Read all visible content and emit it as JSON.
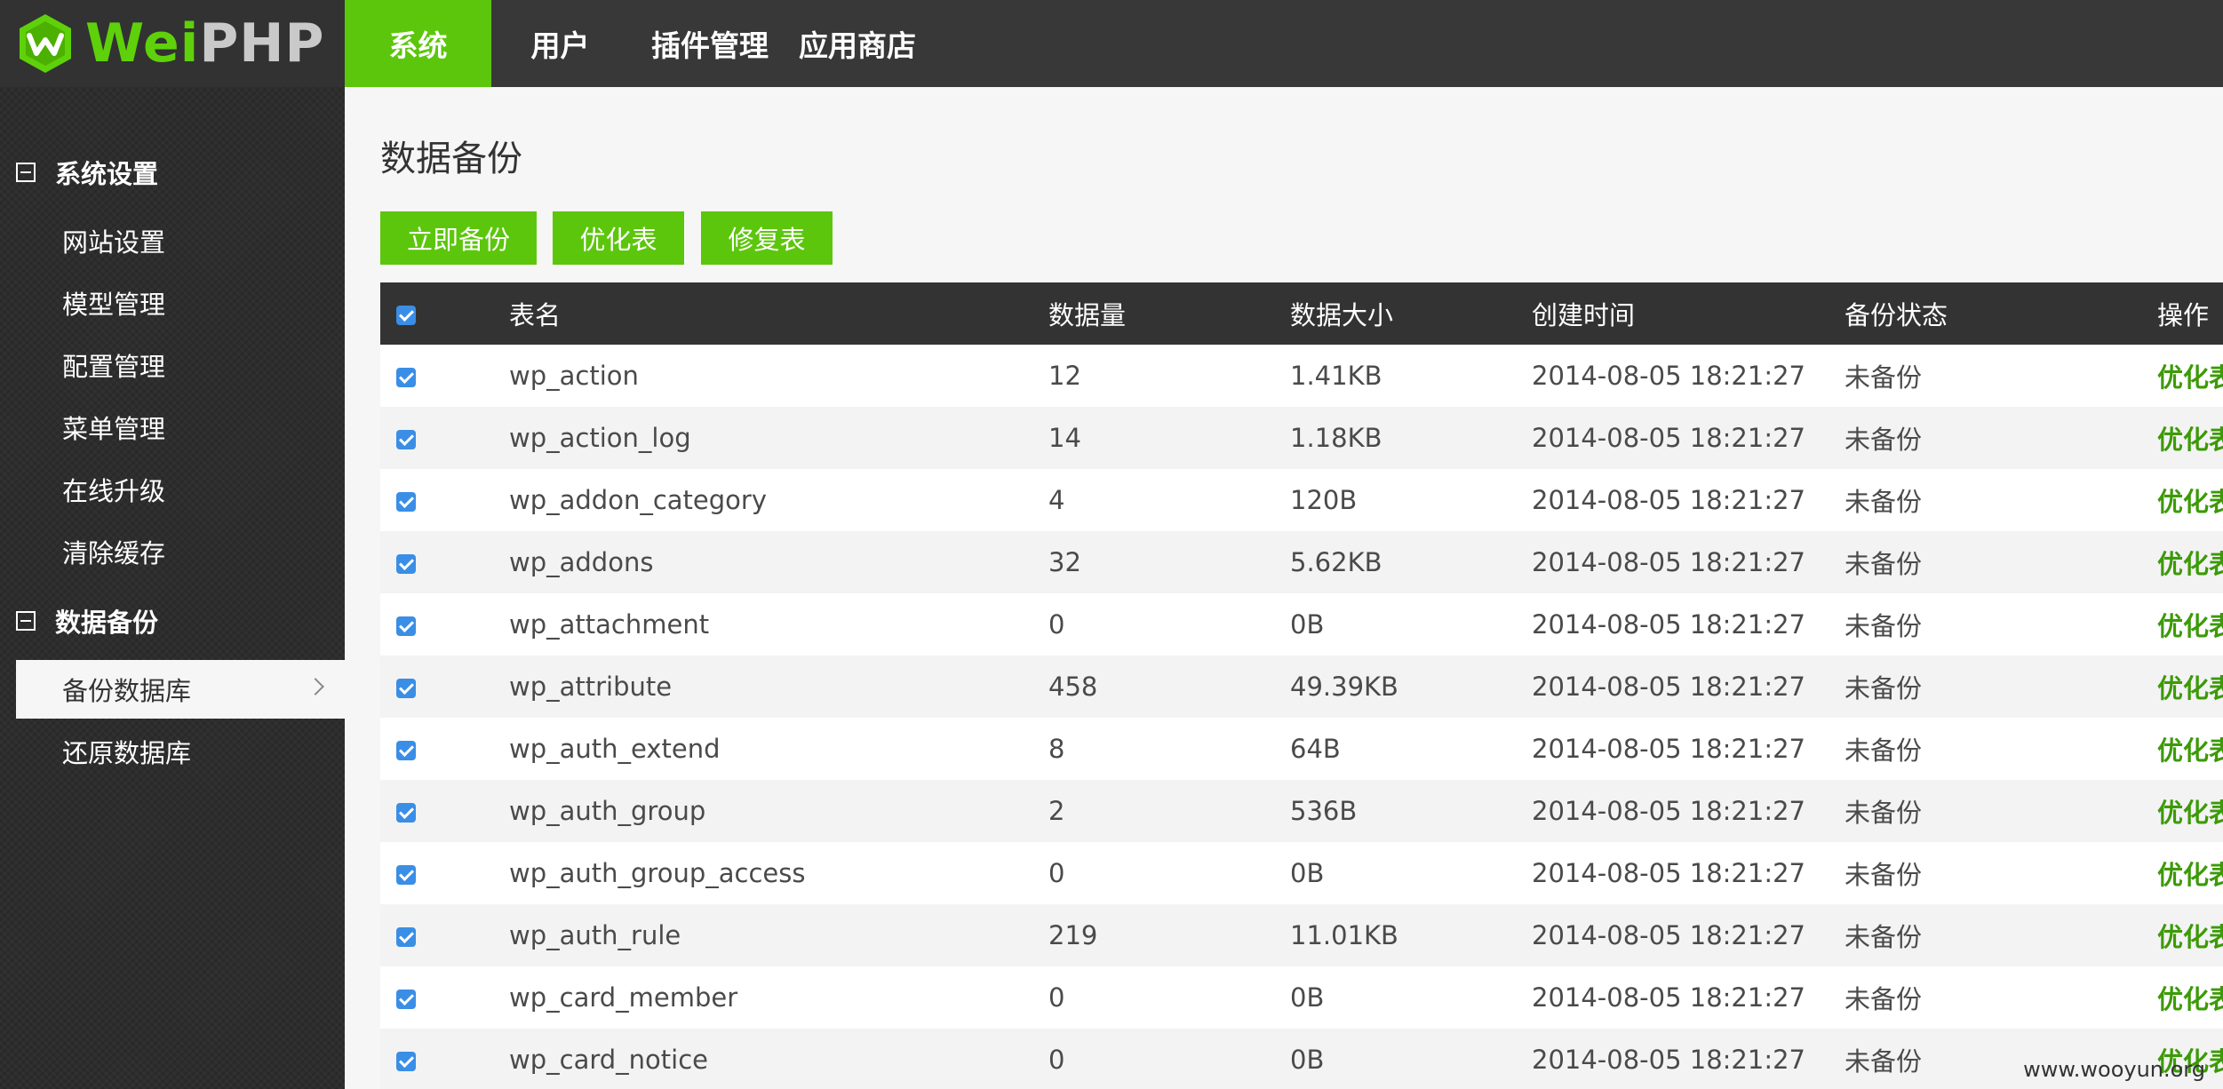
{
  "brand": {
    "wei": "Wei",
    "php": "PHP"
  },
  "topnav": [
    {
      "label": "系统",
      "active": true
    },
    {
      "label": "用户"
    },
    {
      "label": "插件管理"
    },
    {
      "label": "应用商店"
    }
  ],
  "sidebar": {
    "groups": [
      {
        "label": "系统设置",
        "items": [
          "网站设置",
          "模型管理",
          "配置管理",
          "菜单管理",
          "在线升级",
          "清除缓存"
        ]
      },
      {
        "label": "数据备份",
        "items": [
          "备份数据库",
          "还原数据库"
        ]
      }
    ],
    "active_item": "备份数据库"
  },
  "page": {
    "title": "数据备份",
    "buttons": {
      "backup": "立即备份",
      "optimize": "优化表",
      "repair": "修复表"
    }
  },
  "table": {
    "headers": [
      "表名",
      "数据量",
      "数据大小",
      "创建时间",
      "备份状态",
      "操作"
    ],
    "rows": [
      {
        "name": "wp_action",
        "count": "12",
        "size": "1.41KB",
        "time": "2014-08-05 18:21:27",
        "status": "未备份",
        "op": "优化表"
      },
      {
        "name": "wp_action_log",
        "count": "14",
        "size": "1.18KB",
        "time": "2014-08-05 18:21:27",
        "status": "未备份",
        "op": "优化表"
      },
      {
        "name": "wp_addon_category",
        "count": "4",
        "size": "120B",
        "time": "2014-08-05 18:21:27",
        "status": "未备份",
        "op": "优化表"
      },
      {
        "name": "wp_addons",
        "count": "32",
        "size": "5.62KB",
        "time": "2014-08-05 18:21:27",
        "status": "未备份",
        "op": "优化表"
      },
      {
        "name": "wp_attachment",
        "count": "0",
        "size": "0B",
        "time": "2014-08-05 18:21:27",
        "status": "未备份",
        "op": "优化表"
      },
      {
        "name": "wp_attribute",
        "count": "458",
        "size": "49.39KB",
        "time": "2014-08-05 18:21:27",
        "status": "未备份",
        "op": "优化表"
      },
      {
        "name": "wp_auth_extend",
        "count": "8",
        "size": "64B",
        "time": "2014-08-05 18:21:27",
        "status": "未备份",
        "op": "优化表"
      },
      {
        "name": "wp_auth_group",
        "count": "2",
        "size": "536B",
        "time": "2014-08-05 18:21:27",
        "status": "未备份",
        "op": "优化表"
      },
      {
        "name": "wp_auth_group_access",
        "count": "0",
        "size": "0B",
        "time": "2014-08-05 18:21:27",
        "status": "未备份",
        "op": "优化表"
      },
      {
        "name": "wp_auth_rule",
        "count": "219",
        "size": "11.01KB",
        "time": "2014-08-05 18:21:27",
        "status": "未备份",
        "op": "优化表"
      },
      {
        "name": "wp_card_member",
        "count": "0",
        "size": "0B",
        "time": "2014-08-05 18:21:27",
        "status": "未备份",
        "op": "优化表"
      },
      {
        "name": "wp_card_notice",
        "count": "0",
        "size": "0B",
        "time": "2014-08-05 18:21:27",
        "status": "未备份",
        "op": "优化表"
      }
    ]
  },
  "watermark": "www.wooyun.org",
  "colors": {
    "accent": "#5cc60c",
    "topbar": "#383838",
    "sidebar": "#2d2d2d",
    "checkbox": "#3a8ee6",
    "link": "#3c9a08"
  },
  "icons": {
    "logo": "weiphp-logo-icon",
    "collapse": "collapse-minus-icon",
    "chevron": "chevron-right-icon",
    "checkbox": "checkbox-checked-icon"
  }
}
